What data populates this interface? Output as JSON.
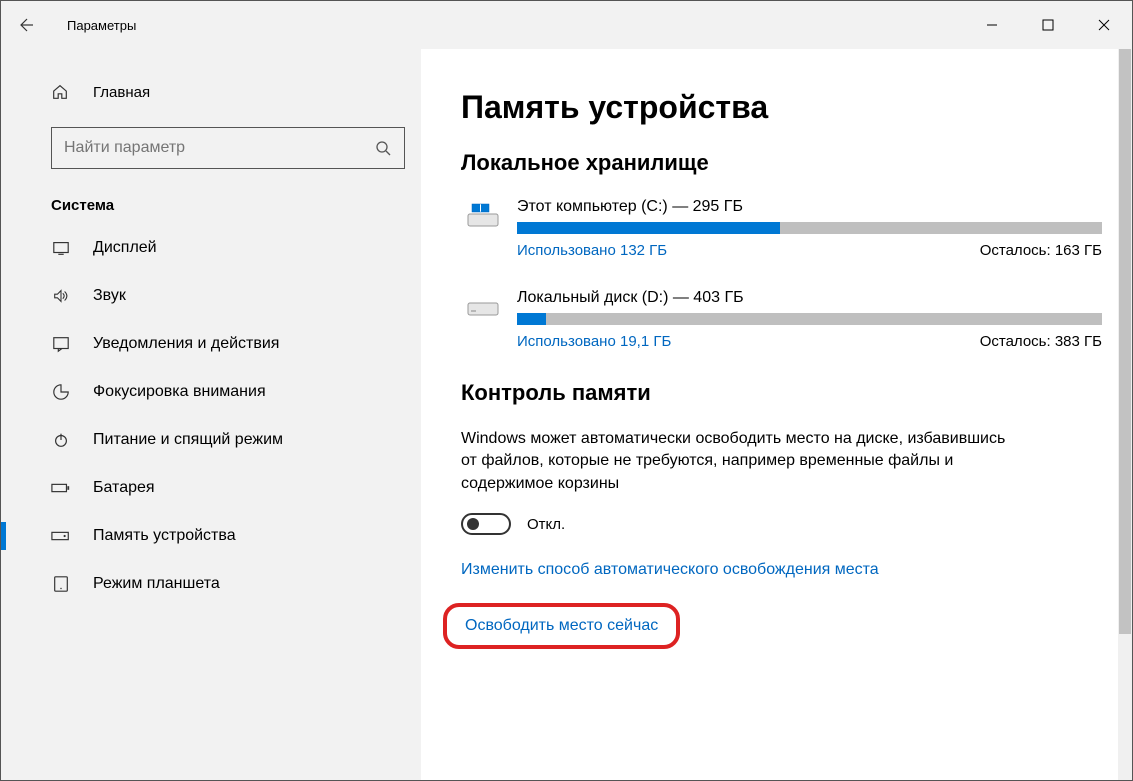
{
  "window": {
    "title": "Параметры"
  },
  "sidebar": {
    "home": "Главная",
    "search_placeholder": "Найти параметр",
    "category": "Система",
    "items": [
      {
        "label": "Дисплей"
      },
      {
        "label": "Звук"
      },
      {
        "label": "Уведомления и действия"
      },
      {
        "label": "Фокусировка внимания"
      },
      {
        "label": "Питание и спящий режим"
      },
      {
        "label": "Батарея"
      },
      {
        "label": "Память устройства"
      },
      {
        "label": "Режим планшета"
      }
    ]
  },
  "main": {
    "title": "Память устройства",
    "local_storage_header": "Локальное хранилище",
    "drives": [
      {
        "name": "Этот компьютер (C:) — 295 ГБ",
        "used": "Использовано 132 ГБ",
        "free": "Осталось: 163 ГБ",
        "fill_pct": 45
      },
      {
        "name": "Локальный диск (D:) — 403 ГБ",
        "used": "Использовано 19,1 ГБ",
        "free": "Осталось: 383 ГБ",
        "fill_pct": 5
      }
    ],
    "sense_header": "Контроль памяти",
    "sense_description": "Windows может автоматически освободить место на диске, избавившись от файлов, которые не требуются, например временные файлы и содержимое корзины",
    "toggle_label": "Откл.",
    "link_change": "Изменить способ автоматического освобождения места",
    "link_free_now": "Освободить место сейчас"
  }
}
